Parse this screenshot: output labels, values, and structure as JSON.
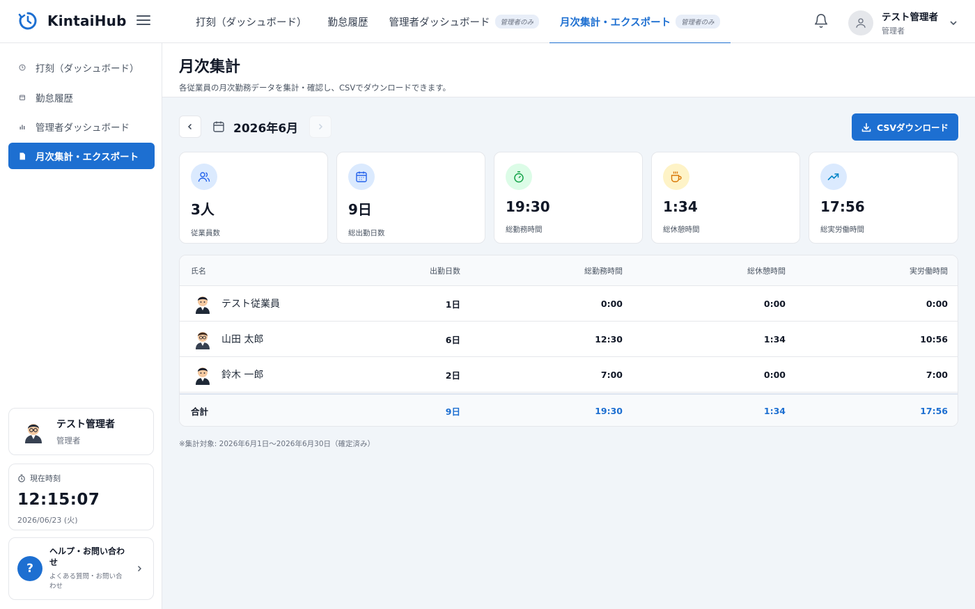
{
  "app": {
    "name": "KintaiHub"
  },
  "topnav": {
    "items": [
      {
        "label": "打刻（ダッシュボード）",
        "badge": ""
      },
      {
        "label": "勤怠履歴",
        "badge": ""
      },
      {
        "label": "管理者ダッシュボード",
        "badge": "管理者のみ"
      },
      {
        "label": "月次集計・エクスポート",
        "badge": "管理者のみ"
      }
    ],
    "active_index": 3
  },
  "user": {
    "name": "テスト管理者",
    "role": "管理者"
  },
  "sidebar": {
    "items": [
      {
        "label": "打刻（ダッシュボード）",
        "icon": "clock-icon"
      },
      {
        "label": "勤怠履歴",
        "icon": "calendar-icon"
      },
      {
        "label": "管理者ダッシュボード",
        "icon": "bar-chart-icon"
      },
      {
        "label": "月次集計・エクスポート",
        "icon": "document-icon"
      }
    ],
    "active_index": 3,
    "clock": {
      "label": "現在時刻",
      "time": "12:15:07",
      "date": "2026/06/23 (火)"
    },
    "help": {
      "title": "ヘルプ・お問い合わせ",
      "subtitle": "よくある質問・お問い合わせ",
      "icon_text": "?"
    }
  },
  "page": {
    "title": "月次集計",
    "description": "各従業員の月次勤務データを集計・確認し、CSVでダウンロードできます。",
    "month": "2026年6月",
    "csv_button": "CSVダウンロード",
    "note": "※集計対象: 2026年6月1日〜2026年6月30日（確定済み）"
  },
  "stats": [
    {
      "value": "3人",
      "label": "従業員数",
      "icon": "users-icon",
      "color": "#2563eb",
      "bg": "#dbeafe"
    },
    {
      "value": "9日",
      "label": "総出勤日数",
      "icon": "calendar-icon",
      "color": "#2563eb",
      "bg": "#dbeafe"
    },
    {
      "value": "19:30",
      "label": "総勤務時間",
      "icon": "stopwatch-icon",
      "color": "#16a34a",
      "bg": "#dcfce7"
    },
    {
      "value": "1:34",
      "label": "総休憩時間",
      "icon": "coffee-icon",
      "color": "#d97706",
      "bg": "#fef3c7"
    },
    {
      "value": "17:56",
      "label": "総実労働時間",
      "icon": "trending-up-icon",
      "color": "#0284c7",
      "bg": "#dbeafe"
    }
  ],
  "table": {
    "headers": {
      "name": "氏名",
      "days": "出勤日数",
      "work": "総勤務時間",
      "break": "総休憩時間",
      "actual": "実労働時間"
    },
    "rows": [
      {
        "name": "テスト従業員",
        "days": "1日",
        "work": "0:00",
        "break": "0:00",
        "actual": "0:00"
      },
      {
        "name": "山田 太郎",
        "days": "6日",
        "work": "12:30",
        "break": "1:34",
        "actual": "10:56"
      },
      {
        "name": "鈴木 一郎",
        "days": "2日",
        "work": "7:00",
        "break": "0:00",
        "actual": "7:00"
      }
    ],
    "total": {
      "name": "合計",
      "days": "9日",
      "work": "19:30",
      "break": "1:34",
      "actual": "17:56"
    }
  },
  "colors": {
    "accent": "#1d6fd1"
  }
}
